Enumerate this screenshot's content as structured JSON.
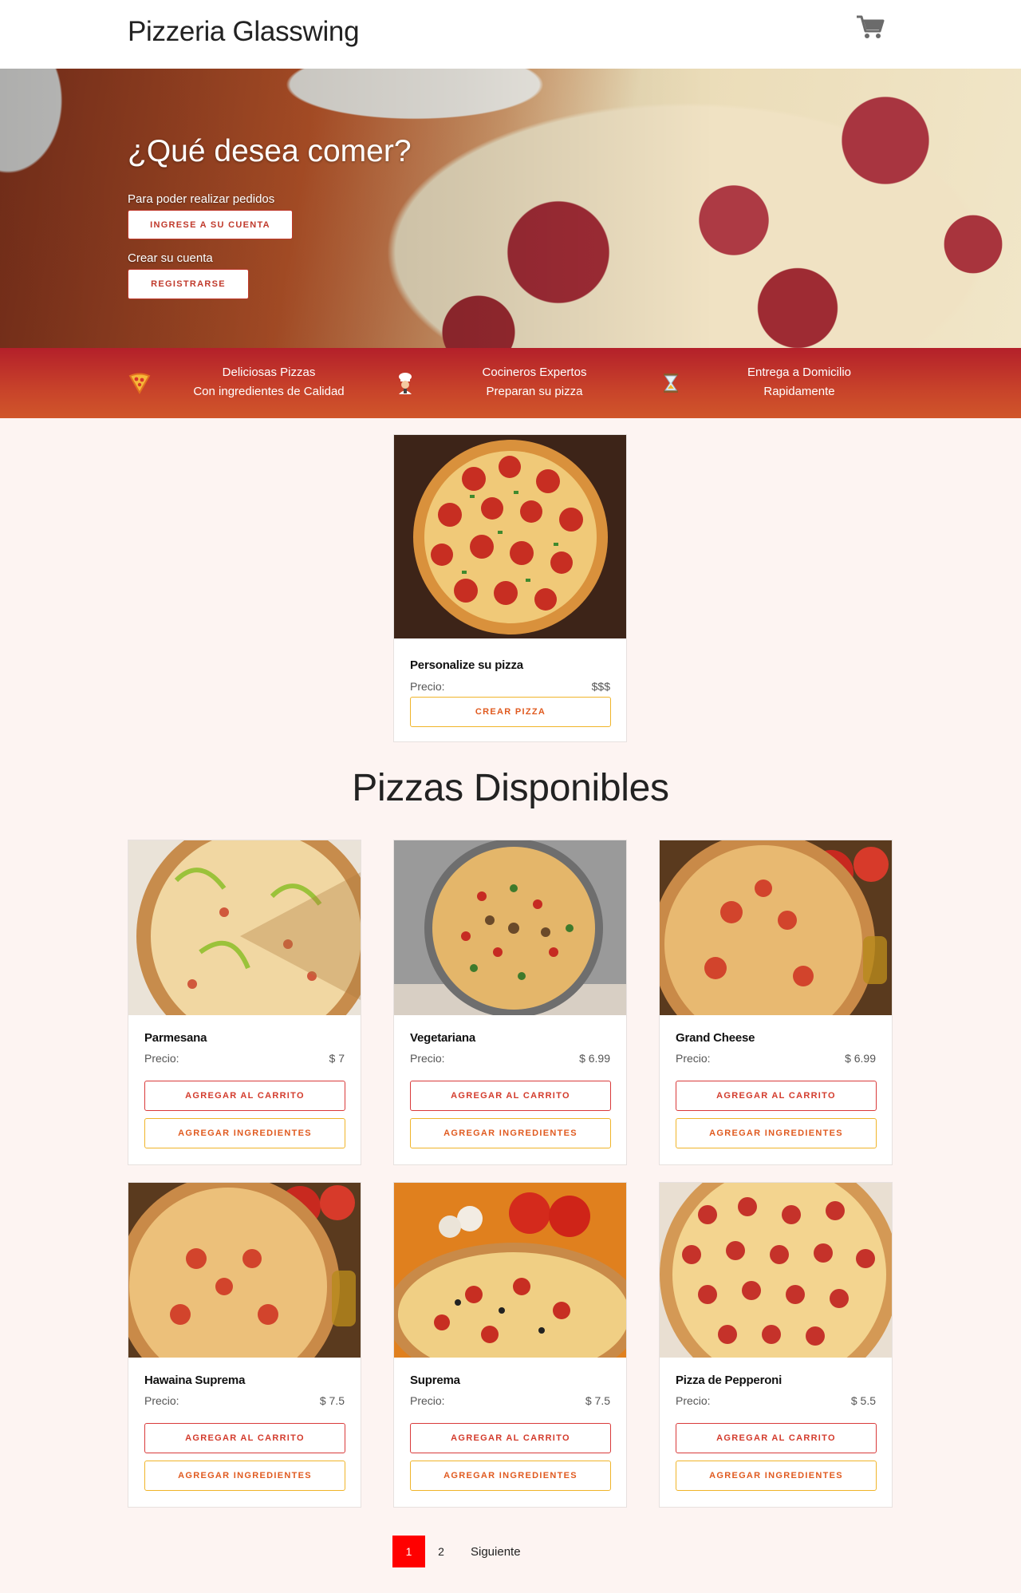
{
  "header": {
    "brand": "Pizzeria Glasswing",
    "cart_icon": "shopping-cart-icon"
  },
  "hero": {
    "title": "¿Qué desea comer?",
    "login_prompt": "Para poder realizar pedidos",
    "login_button": "INGRESE A SU CUENTA",
    "register_prompt": "Crear su cuenta",
    "register_button": "REGISTRARSE"
  },
  "features": [
    {
      "icon": "pizza-slice-icon",
      "line1": "Deliciosas Pizzas",
      "line2": "Con ingredientes de Calidad"
    },
    {
      "icon": "chef-icon",
      "line1": "Cocineros Expertos",
      "line2": "Preparan su pizza"
    },
    {
      "icon": "hourglass-icon",
      "line1": "Entrega a Domicilio",
      "line2": "Rapidamente"
    }
  ],
  "custom_pizza": {
    "name": "Personalize su pizza",
    "price_label": "Precio:",
    "price": "$$$",
    "button": "CREAR PIZZA"
  },
  "section_title": "Pizzas Disponibles",
  "pizzas": [
    {
      "name": "Parmesana",
      "price_label": "Precio:",
      "price": "$ 7",
      "cart_button": "AGREGAR AL CARRITO",
      "ingredients_button": "AGREGAR INGREDIENTES"
    },
    {
      "name": "Vegetariana",
      "price_label": "Precio:",
      "price": "$ 6.99",
      "cart_button": "AGREGAR AL CARRITO",
      "ingredients_button": "AGREGAR INGREDIENTES"
    },
    {
      "name": "Grand Cheese",
      "price_label": "Precio:",
      "price": "$ 6.99",
      "cart_button": "AGREGAR AL CARRITO",
      "ingredients_button": "AGREGAR INGREDIENTES"
    },
    {
      "name": "Hawaina Suprema",
      "price_label": "Precio:",
      "price": "$ 7.5",
      "cart_button": "AGREGAR AL CARRITO",
      "ingredients_button": "AGREGAR INGREDIENTES"
    },
    {
      "name": "Suprema",
      "price_label": "Precio:",
      "price": "$ 7.5",
      "cart_button": "AGREGAR AL CARRITO",
      "ingredients_button": "AGREGAR INGREDIENTES"
    },
    {
      "name": "Pizza de Pepperoni",
      "price_label": "Precio:",
      "price": "$ 5.5",
      "cart_button": "AGREGAR AL CARRITO",
      "ingredients_button": "AGREGAR INGREDIENTES"
    }
  ],
  "pagination": {
    "current": "1",
    "page2": "2",
    "next": "Siguiente"
  },
  "colors": {
    "accent_red": "#d33b2c",
    "accent_yellow": "#f0b429",
    "active_page": "#ff0000",
    "band": "#c0392b"
  }
}
